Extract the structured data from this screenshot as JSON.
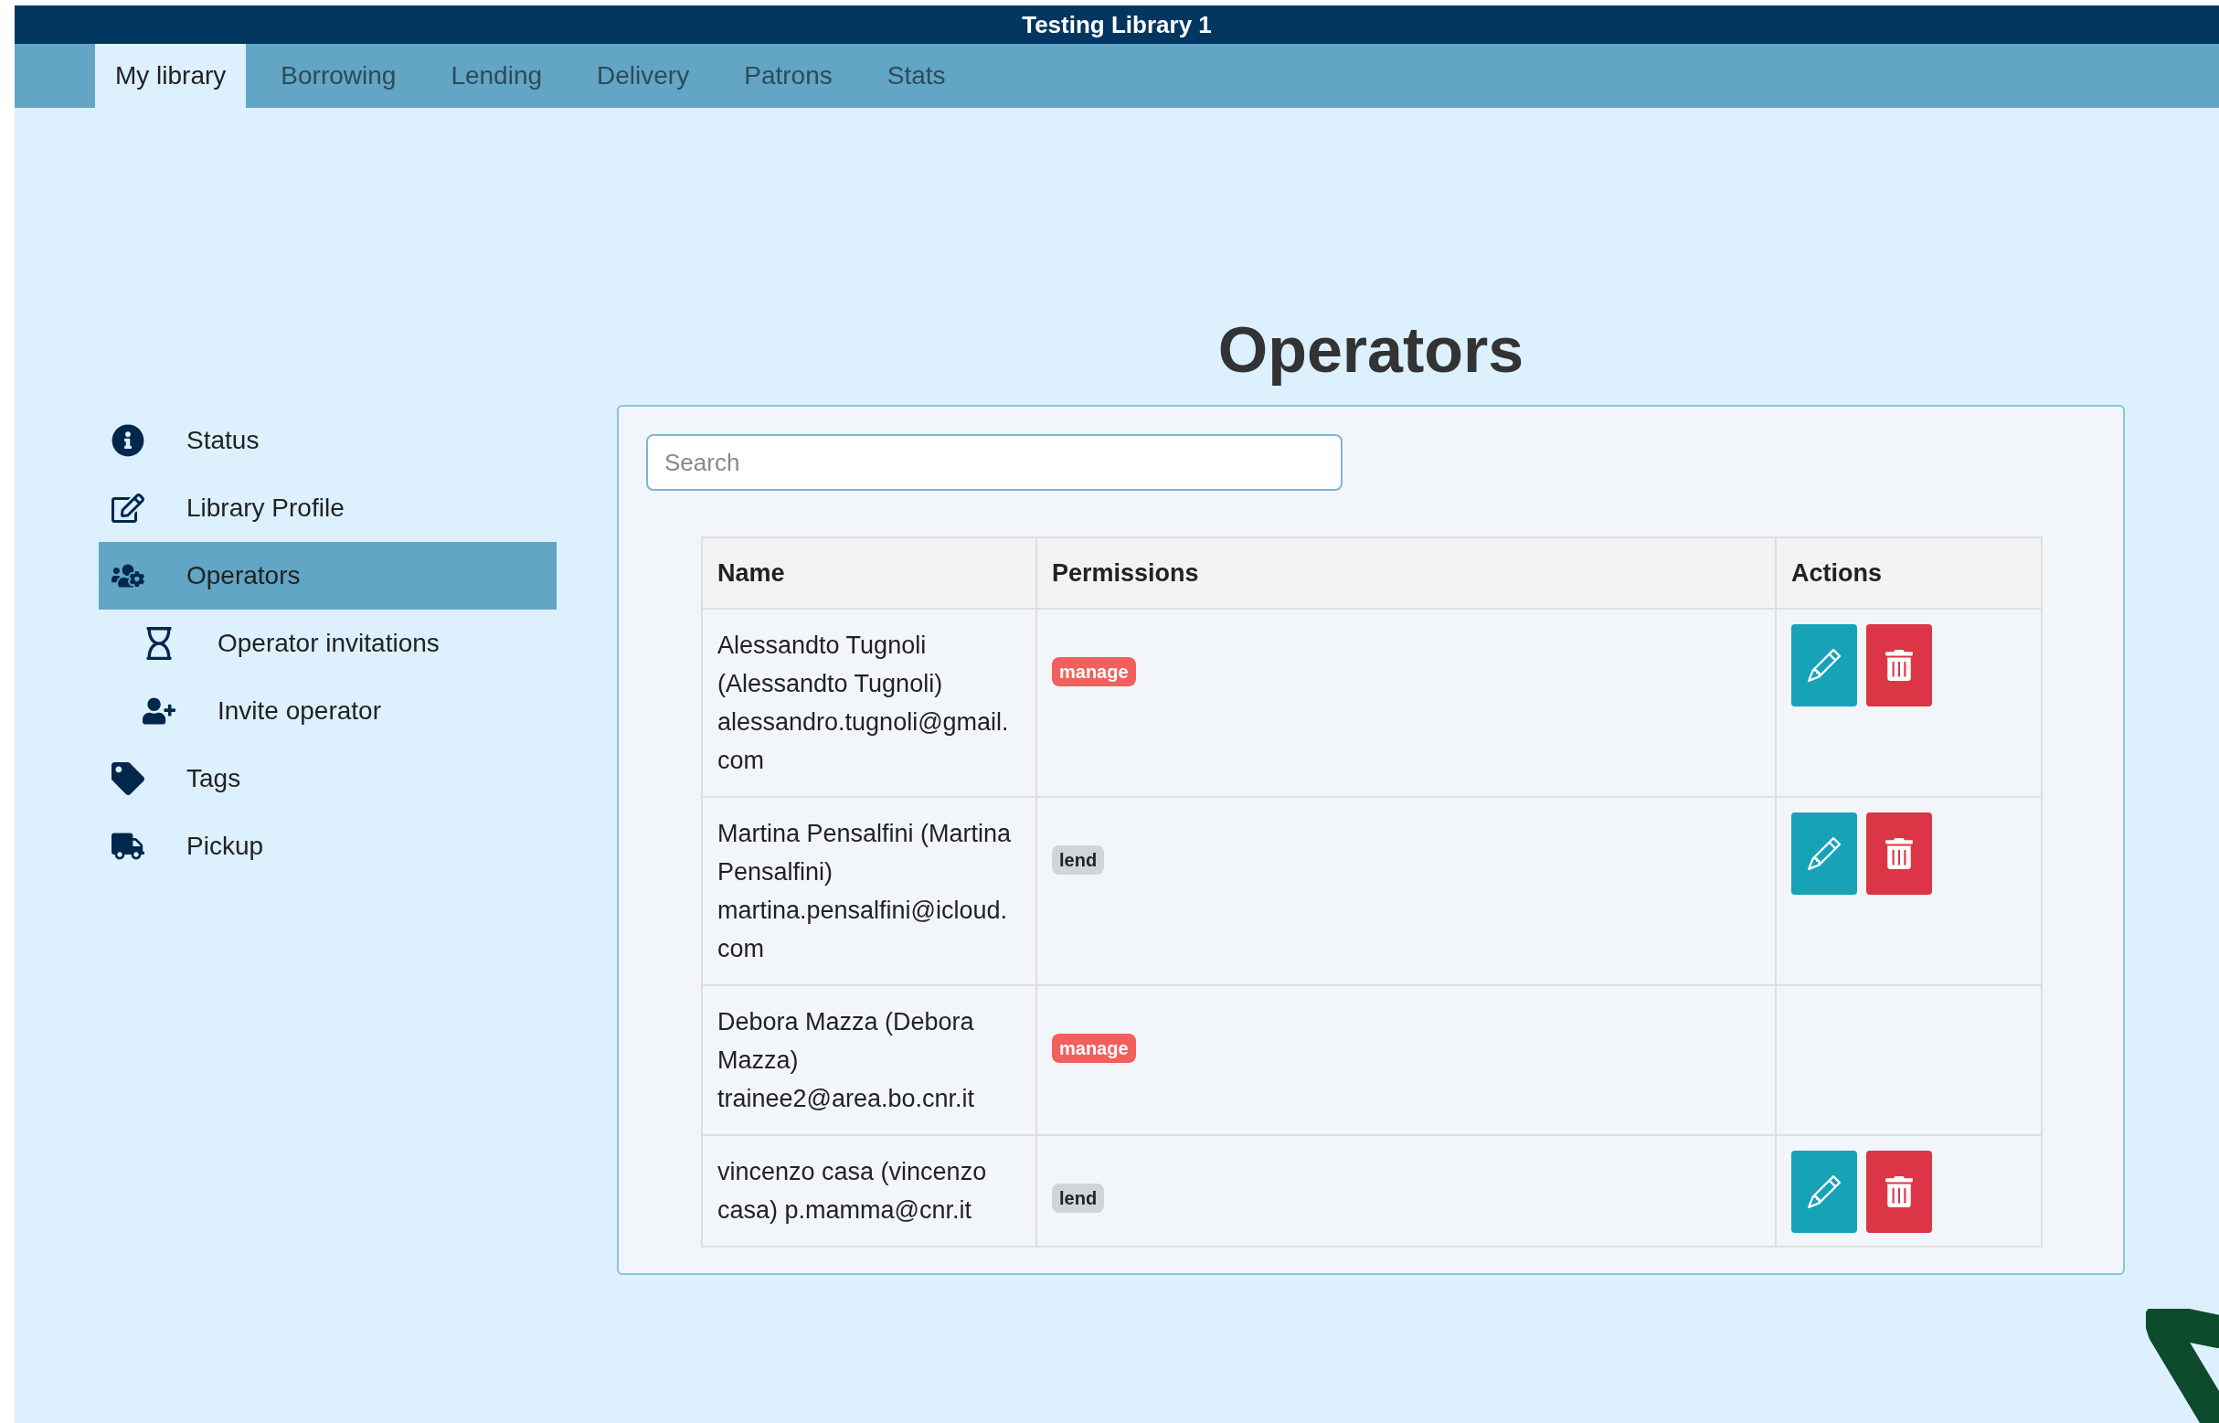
{
  "window": {
    "title": "Testing Library 1"
  },
  "tabs": [
    {
      "label": "My library",
      "selected": true
    },
    {
      "label": "Borrowing",
      "selected": false
    },
    {
      "label": "Lending",
      "selected": false
    },
    {
      "label": "Delivery",
      "selected": false
    },
    {
      "label": "Patrons",
      "selected": false
    },
    {
      "label": "Stats",
      "selected": false
    }
  ],
  "page": {
    "heading": "Operators"
  },
  "sidebar": {
    "items": [
      {
        "label": "Status",
        "selected": false
      },
      {
        "label": "Library Profile",
        "selected": false
      },
      {
        "label": "Operators",
        "selected": true,
        "children": [
          {
            "label": "Operator invitations",
            "selected": false
          },
          {
            "label": "Invite operator",
            "selected": false
          }
        ]
      },
      {
        "label": "Tags",
        "selected": false
      },
      {
        "label": "Pickup",
        "selected": false
      }
    ]
  },
  "search": {
    "placeholder": "Search"
  },
  "table": {
    "columns": [
      "Name",
      "Permissions",
      "Actions"
    ],
    "rows": [
      {
        "name": "Alessandto Tugnoli (Alessandto Tugnoli) alessandro.tugnoli@gmail.com",
        "permission": {
          "label": "manage",
          "kind": "danger"
        },
        "has_actions": true
      },
      {
        "name": "Martina Pensalfini (Martina Pensalfini) martina.pensalfini@icloud.com",
        "permission": {
          "label": "lend",
          "kind": "secondary"
        },
        "has_actions": true
      },
      {
        "name": "Debora Mazza (Debora Mazza) trainee2@area.bo.cnr.it",
        "permission": {
          "label": "manage",
          "kind": "danger"
        },
        "has_actions": false
      },
      {
        "name": "vincenzo casa (vincenzo casa) p.mamma@cnr.it",
        "permission": {
          "label": "lend",
          "kind": "secondary"
        },
        "has_actions": true
      }
    ]
  }
}
